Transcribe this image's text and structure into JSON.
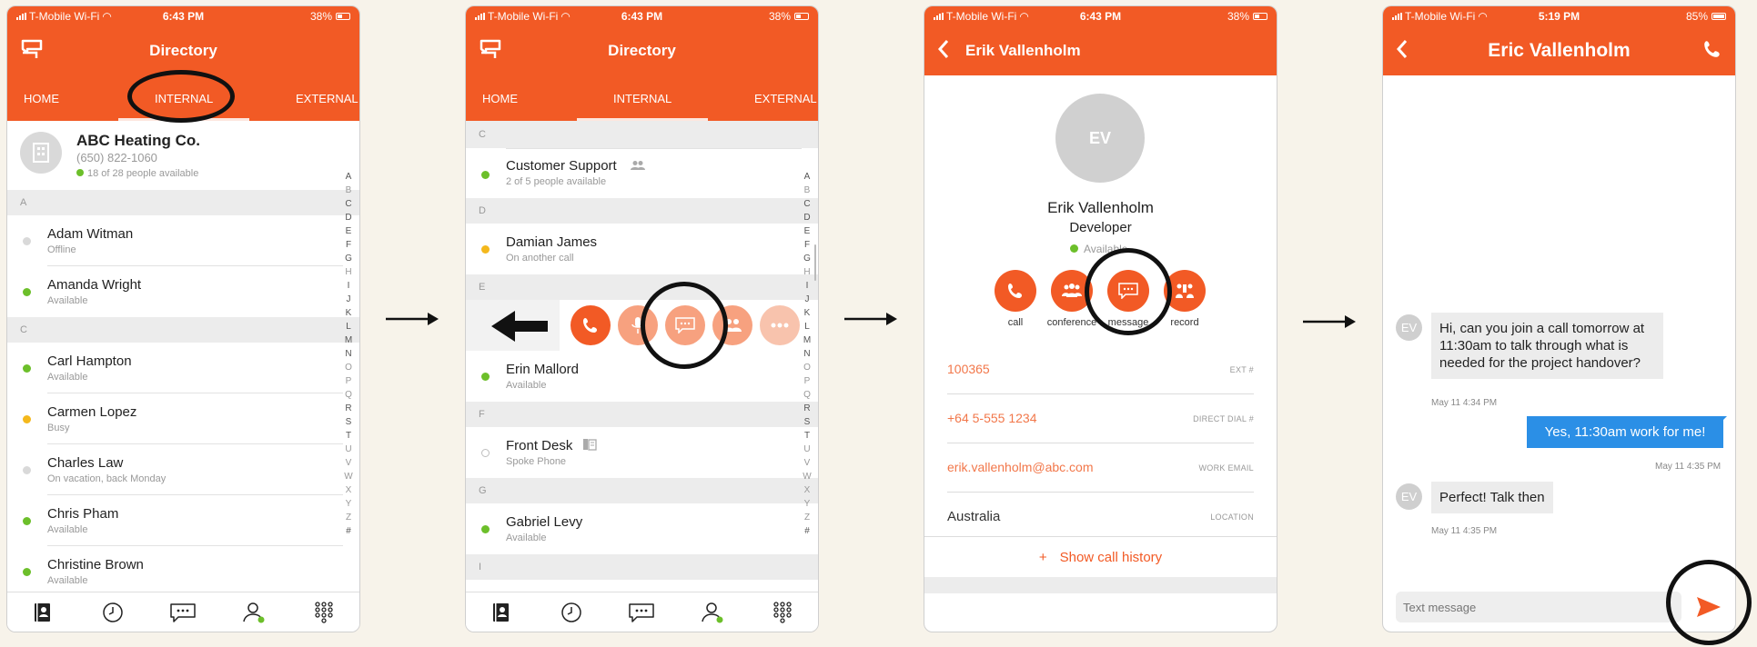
{
  "status_common": {
    "carrier": "T-Mobile Wi-Fi",
    "time": "6:43 PM",
    "battery": "38%"
  },
  "screen1": {
    "title": "Directory",
    "tabs": [
      "HOME",
      "INTERNAL",
      "EXTERNAL"
    ],
    "company": {
      "name": "ABC Heating Co.",
      "phone": "(650) 822-1060",
      "availability": "18 of 28 people available"
    },
    "groups": [
      {
        "letter": "A",
        "people": [
          {
            "name": "Adam Witman",
            "status": "Offline",
            "dot": "grey"
          },
          {
            "name": "Amanda Wright",
            "status": "Available",
            "dot": "green"
          }
        ]
      },
      {
        "letter": "C",
        "people": [
          {
            "name": "Carl Hampton",
            "status": "Available",
            "dot": "green"
          },
          {
            "name": "Carmen Lopez",
            "status": "Busy",
            "dot": "yellow"
          },
          {
            "name": "Charles Law",
            "status": "On vacation, back Monday",
            "dot": "grey"
          },
          {
            "name": "Chris Pham",
            "status": "Available",
            "dot": "green"
          },
          {
            "name": "Christine Brown",
            "status": "Available",
            "dot": "green"
          }
        ]
      }
    ]
  },
  "screen2": {
    "title": "Directory",
    "tabs": [
      "HOME",
      "INTERNAL",
      "EXTERNAL"
    ],
    "headers": [
      "C",
      "D",
      "E",
      "F",
      "G",
      "I"
    ],
    "customer_support": {
      "name": "Customer Support",
      "status": "2 of 5 people available"
    },
    "damian": {
      "name": "Damian James",
      "status": "On another call"
    },
    "erin": {
      "name": "Erin Mallord",
      "status": "Available"
    },
    "front_desk": {
      "name": "Front Desk",
      "status": "Spoke Phone"
    },
    "gabriel": {
      "name": "Gabriel Levy",
      "status": "Available"
    }
  },
  "alphabet": [
    "A",
    "B",
    "C",
    "D",
    "E",
    "F",
    "G",
    "H",
    "I",
    "J",
    "K",
    "L",
    "M",
    "N",
    "O",
    "P",
    "Q",
    "R",
    "S",
    "T",
    "U",
    "V",
    "W",
    "X",
    "Y",
    "Z",
    "#"
  ],
  "screen3": {
    "header_name": "Erik Vallenholm",
    "initials": "EV",
    "name": "Erik Vallenholm",
    "role": "Developer",
    "availability": "Available",
    "actions": [
      "call",
      "conference",
      "message",
      "record"
    ],
    "fields": [
      {
        "value": "100365",
        "label": "EXT #"
      },
      {
        "value": "+64 5-555 1234",
        "label": "DIRECT DIAL #"
      },
      {
        "value": "erik.vallenholm@abc.com",
        "label": "WORK EMAIL"
      },
      {
        "value": "Australia",
        "label": "LOCATION"
      }
    ],
    "history": "Show call history",
    "history_plus": "+"
  },
  "screen4": {
    "status": {
      "carrier": "T-Mobile Wi-Fi",
      "time": "5:19 PM",
      "battery": "85%"
    },
    "title": "Eric Vallenholm",
    "initials": "EV",
    "messages": [
      {
        "dir": "in",
        "text": "Hi, can you join a call tomorrow at 11:30am to talk through what is needed for the project handover?",
        "time": "May 11 4:34 PM"
      },
      {
        "dir": "out",
        "text": "Yes, 11:30am work for me!",
        "time": "May 11 4:35 PM"
      },
      {
        "dir": "in",
        "text": "Perfect! Talk then",
        "time": "May 11 4:35 PM"
      }
    ],
    "placeholder": "Text message"
  },
  "colors": {
    "brand": "#f25a25",
    "available": "#6cbf2a",
    "busy": "#f4b81c",
    "offline": "#d9d9d9",
    "outgoing": "#2b8fe6"
  }
}
